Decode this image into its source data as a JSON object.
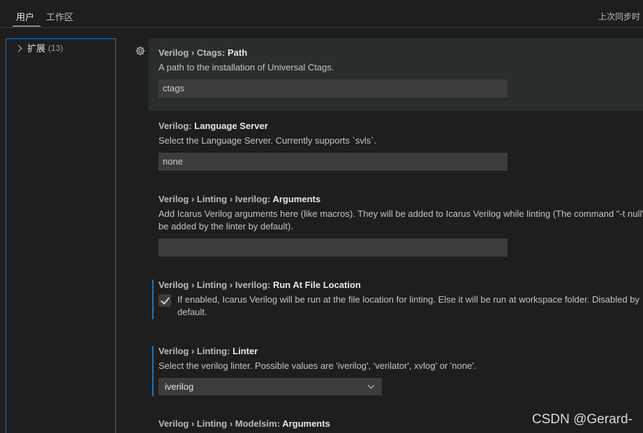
{
  "tabs": {
    "user": "用户",
    "workspace": "工作区",
    "sync_status": "上次同步时"
  },
  "toc": {
    "item_label": "扩展",
    "item_count": "(13)"
  },
  "settings": [
    {
      "category": "Verilog › Ctags: ",
      "name": "Path",
      "description": "A path to the installation of Universal Ctags.",
      "value": "ctags"
    },
    {
      "category": "Verilog: ",
      "name": "Language Server",
      "description": "Select the Language Server. Currently supports `svls`.",
      "value": "none"
    },
    {
      "category": "Verilog › Linting › Iverilog: ",
      "name": "Arguments",
      "description": "Add Icarus Verilog arguments here (like macros). They will be added to Icarus Verilog while linting (The command \"-t null\"",
      "description2": "be added by the linter by default).",
      "value": ""
    },
    {
      "category": "Verilog › Linting › Iverilog: ",
      "name": "Run At File Location",
      "description": "If enabled, Icarus Verilog will be run at the file location for linting. Else it will be run at workspace folder. Disabled by",
      "description2": "default.",
      "checked": true
    },
    {
      "category": "Verilog › Linting: ",
      "name": "Linter",
      "description": "Select the verilog linter. Possible values are 'iverilog', 'verilator', xvlog' or 'none'.",
      "value": "iverilog"
    },
    {
      "category": "Verilog › Linting › Modelsim: ",
      "name": "Arguments"
    }
  ],
  "watermark": "CSDN @Gerard-"
}
